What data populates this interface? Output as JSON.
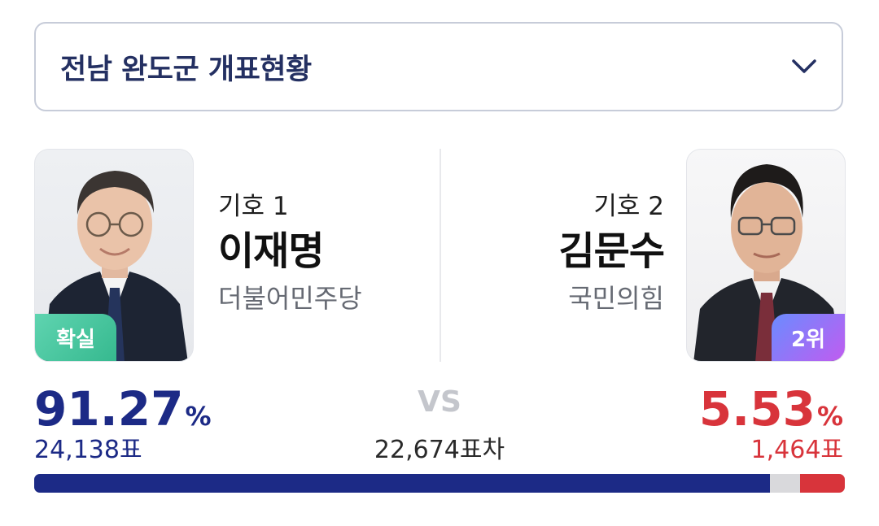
{
  "region": {
    "title": "전남 완도군 개표현황",
    "dropdown_icon": "chevron-down-icon"
  },
  "candidates": [
    {
      "number": "기호 1",
      "name": "이재명",
      "party": "더불어민주당",
      "badge": "확실",
      "percent": "91.27",
      "percent_unit": "%",
      "votes": "24,138표",
      "color": "#1c2a86",
      "bar_share": 0.9127
    },
    {
      "number": "기호 2",
      "name": "김문수",
      "party": "국민의힘",
      "badge": "2위",
      "percent": "5.53",
      "percent_unit": "%",
      "votes": "1,464표",
      "color": "#d8343b",
      "bar_share": 0.0553
    }
  ],
  "vs_label": "VS",
  "vote_gap": "22,674표차",
  "colors": {
    "confirmed_badge": "#36b98f",
    "rank_badge": "#a56cf2",
    "other_share": "#d9d9dc"
  }
}
